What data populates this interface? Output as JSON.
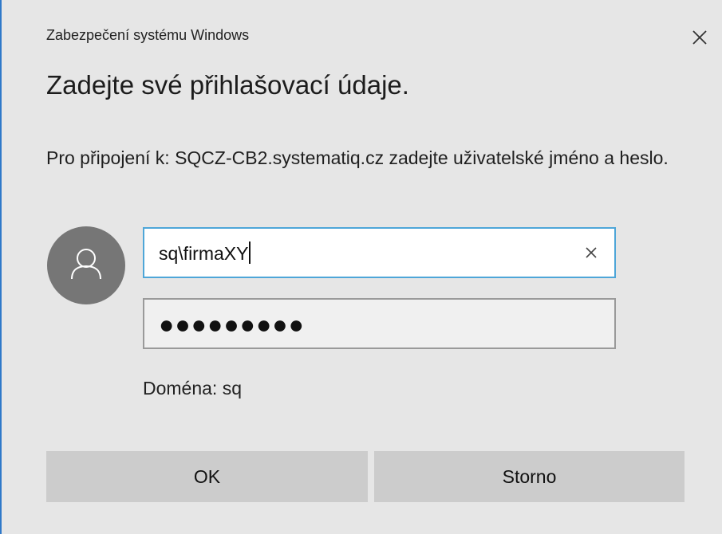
{
  "window": {
    "title": "Zabezpečení systému Windows",
    "close_icon": "close-icon"
  },
  "dialog": {
    "heading": "Zadejte své přihlašovací údaje.",
    "description": "Pro připojení k: SQCZ-CB2.systematiq.cz zadejte uživatelské jméno a heslo.",
    "avatar_icon": "user-icon"
  },
  "username": {
    "value": "sq\\firmaXY",
    "clear_icon": "clear-icon",
    "focused": true
  },
  "password": {
    "masked_value": "●●●●●●●●●"
  },
  "domain": {
    "label": "Doména: sq"
  },
  "buttons": {
    "ok_label": "OK",
    "cancel_label": "Storno"
  },
  "colors": {
    "background": "#e6e6e6",
    "focus_border": "#4ea6d8",
    "button_bg": "#cccccc",
    "avatar_bg": "#767676"
  }
}
